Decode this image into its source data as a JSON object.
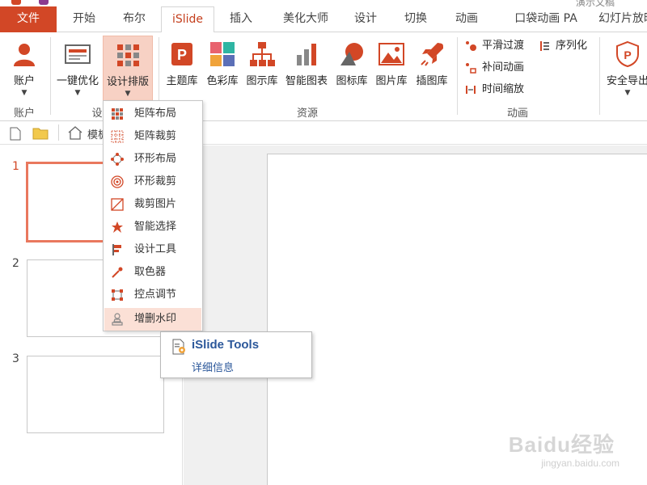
{
  "window": {
    "title": "演示文稿"
  },
  "tabs": [
    "文件",
    "开始",
    "布尔",
    "iSlide",
    "插入",
    "美化大师",
    "设计",
    "切换",
    "动画",
    "口袋动画 PA",
    "幻灯片放映"
  ],
  "active_tab": "iSlide",
  "colors": {
    "accent": "#d24726",
    "pressed": "#f7d1c4",
    "menu_hover": "#fbe0d6",
    "link": "#2b579a"
  },
  "ribbon": {
    "account": {
      "button": "账户",
      "group": "账户"
    },
    "design": {
      "optimize": "一键优化",
      "layout": "设计排版",
      "group_label": "设"
    },
    "resources": {
      "group": "资源",
      "items": [
        "主题库",
        "色彩库",
        "图示库",
        "智能图表",
        "图标库",
        "图片库",
        "插图库"
      ]
    },
    "animation": {
      "group": "动画",
      "smooth": "平滑过渡",
      "serialize": "序列化",
      "tween": "补间动画",
      "time_scale": "时间缩放"
    },
    "security": {
      "export": "安全导出"
    }
  },
  "quick_row": {
    "breadcrumb": "模板"
  },
  "dropdown": {
    "items": [
      "矩阵布局",
      "矩阵裁剪",
      "环形布局",
      "环形裁剪",
      "裁剪图片",
      "智能选择",
      "设计工具",
      "取色器",
      "控点调节",
      "增删水印"
    ],
    "icons": [
      "matrix-layout-icon",
      "matrix-crop-icon",
      "ring-layout-icon",
      "ring-crop-icon",
      "crop-image-icon",
      "smart-select-icon",
      "design-tools-icon",
      "color-picker-icon",
      "handle-adjust-icon",
      "watermark-icon"
    ],
    "hovered": "增删水印"
  },
  "tooltip": {
    "title": "iSlide Tools",
    "link": "详细信息"
  },
  "slides": {
    "numbers": [
      "1",
      "2",
      "3"
    ],
    "selected": "1"
  },
  "watermark": {
    "main": "Baidu经验",
    "sub": "jingyan.baidu.com"
  }
}
